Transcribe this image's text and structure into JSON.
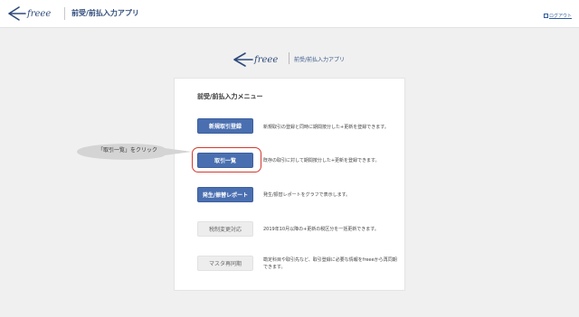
{
  "header": {
    "app_title": "前受/前払入力アプリ",
    "logout_label": "ログアウト",
    "logo_text": "freee"
  },
  "center": {
    "logo_text": "freee",
    "app_title": "前受/前払入力アプリ"
  },
  "card": {
    "title": "前受/前払入力メニュー",
    "items": [
      {
        "label": "新規取引登録",
        "description": "新規取引の登録と同時に期間按分した+更新を登録できます。",
        "enabled": true
      },
      {
        "label": "取引一覧",
        "description": "既存の取引に対して期間按分した+更新を登録できます。",
        "enabled": true
      },
      {
        "label": "発生/振替レポート",
        "description": "発生/振替レポートをグラフで表示します。",
        "enabled": true
      },
      {
        "label": "税制変更対応",
        "description": "2019年10月以降の+更新の税区分を一括更新できます。",
        "enabled": false
      },
      {
        "label": "マスタ再同期",
        "description": "勘定科目や取引先など、取引登録に必要な情報をfreeeから再同期できます。",
        "enabled": false
      }
    ]
  },
  "callout": {
    "text": "「取引一覧」をクリック"
  },
  "colors": {
    "brand": "#2d4a7a",
    "primary_button": "#4a6fb0",
    "highlight": "#d23a2e"
  }
}
